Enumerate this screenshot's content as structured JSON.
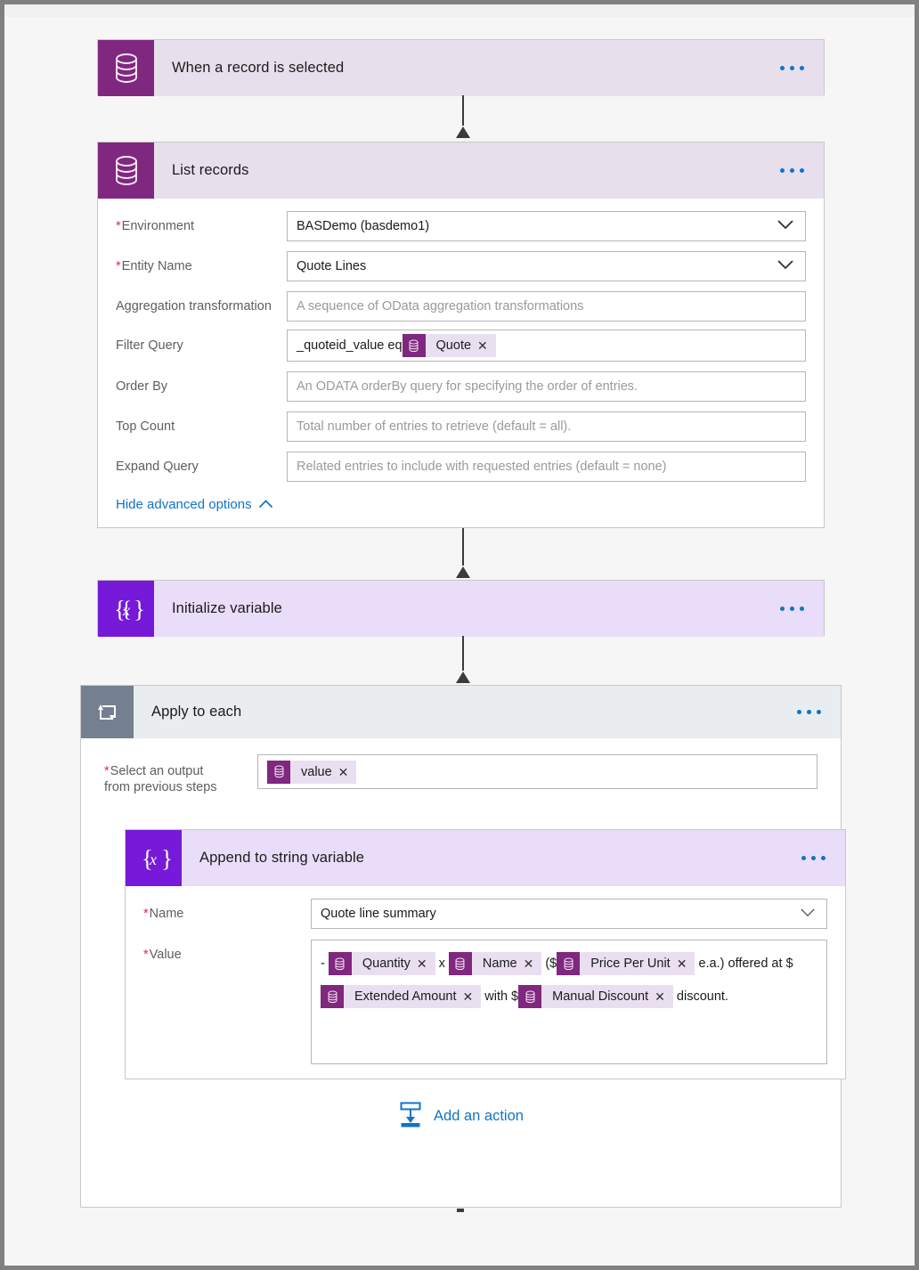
{
  "theme": {
    "accent_blue": "#0f74c8",
    "dataverse_purple": "#80277f",
    "dataverse_lavender": "#e8dfec",
    "variable_violet": "#7719d8",
    "variable_lavender": "#eaddf9",
    "loop_slate": "#74808f",
    "loop_body": "#e9edf0",
    "required_red": "#e3294b",
    "canvas_bg": "#f6f6f6"
  },
  "flow": {
    "trigger": {
      "title": "When a record is selected",
      "icon": "dataverse-database-icon",
      "menu": "more-commands"
    },
    "list_records": {
      "title": "List records",
      "icon": "dataverse-database-icon",
      "fields": [
        {
          "label": "Environment",
          "required": true,
          "type": "dropdown",
          "value": "BASDemo (basdemo1)",
          "placeholder": ""
        },
        {
          "label": "Entity Name",
          "required": true,
          "type": "dropdown",
          "value": "Quote Lines",
          "placeholder": ""
        },
        {
          "label": "Aggregation transformation",
          "required": false,
          "type": "text",
          "value": "",
          "placeholder": "A sequence of OData aggregation transformations"
        },
        {
          "label": "Filter Query",
          "required": false,
          "type": "token-text",
          "prefix": "_quoteid_value eq ",
          "token": "Quote",
          "placeholder": ""
        },
        {
          "label": "Order By",
          "required": false,
          "type": "text",
          "value": "",
          "placeholder": "An ODATA orderBy query for specifying the order of entries."
        },
        {
          "label": "Top Count",
          "required": false,
          "type": "text",
          "value": "",
          "placeholder": "Total number of entries to retrieve (default = all)."
        },
        {
          "label": "Expand Query",
          "required": false,
          "type": "text",
          "value": "",
          "placeholder": "Related entries to include with requested entries (default = none)"
        }
      ],
      "advanced_link": "Hide advanced options"
    },
    "initialize_variable": {
      "title": "Initialize variable",
      "icon": "variable-braces-icon"
    },
    "apply_to_each": {
      "title": "Apply to each",
      "icon": "loop-repeat-icon",
      "select_output": {
        "label_line1": "Select an output",
        "label_line2": "from previous steps",
        "required": true,
        "token": "value"
      },
      "add_action_label": "Add an action",
      "add_action_icon": "add-action-icon"
    },
    "append_to_string": {
      "title": "Append to string variable",
      "icon": "variable-braces-icon",
      "name_field": {
        "label": "Name",
        "required": true,
        "value": "Quote line summary"
      },
      "value_field": {
        "label": "Value",
        "required": true,
        "segments": [
          {
            "kind": "text",
            "text": "- "
          },
          {
            "kind": "token",
            "text": "Quantity"
          },
          {
            "kind": "text",
            "text": " x "
          },
          {
            "kind": "token",
            "text": "Name"
          },
          {
            "kind": "text",
            "text": " ($"
          },
          {
            "kind": "token",
            "text": "Price Per Unit"
          },
          {
            "kind": "text",
            "text": " e.a.) "
          },
          {
            "kind": "text",
            "text": "offered at $"
          },
          {
            "kind": "token",
            "text": "Extended Amount"
          },
          {
            "kind": "text",
            "text": " with $"
          },
          {
            "kind": "token",
            "text": "Manual Discount"
          },
          {
            "kind": "text",
            "text": " discount."
          }
        ]
      }
    }
  }
}
